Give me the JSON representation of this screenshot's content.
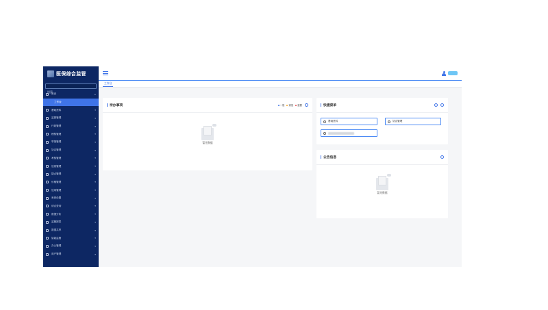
{
  "app": {
    "title": "医保综合监管",
    "search_placeholder": "搜索",
    "accent": "#3f74e8",
    "sidebar_bg": "#0d2763"
  },
  "sidebar": {
    "items": [
      {
        "label": "首页",
        "icon": "home-icon",
        "state": "open"
      },
      {
        "label": "工作台",
        "icon": "",
        "state": "active"
      },
      {
        "label": "基础资料",
        "icon": "database-icon",
        "state": ""
      },
      {
        "label": "监督管理",
        "icon": "shield-icon",
        "state": ""
      },
      {
        "label": "行政管理",
        "icon": "briefcase-icon",
        "state": ""
      },
      {
        "label": "稽核管理",
        "icon": "clipboard-icon",
        "state": ""
      },
      {
        "label": "举报管理",
        "icon": "flag-icon",
        "state": ""
      },
      {
        "label": "协议管理",
        "icon": "document-icon",
        "state": ""
      },
      {
        "label": "考核管理",
        "icon": "chart-icon",
        "state": ""
      },
      {
        "label": "信息管理",
        "icon": "info-icon",
        "state": ""
      },
      {
        "label": "疑点管理",
        "icon": "alert-icon",
        "state": ""
      },
      {
        "label": "价格管理",
        "icon": "tag-icon",
        "state": ""
      },
      {
        "label": "信用管理",
        "icon": "star-icon",
        "state": ""
      },
      {
        "label": "系统设置",
        "icon": "gear-icon",
        "state": ""
      },
      {
        "label": "综合查询",
        "icon": "search-icon",
        "state": ""
      },
      {
        "label": "数据分析",
        "icon": "analysis-icon",
        "state": ""
      },
      {
        "label": "监管报表",
        "icon": "report-icon",
        "state": ""
      },
      {
        "label": "数据共享",
        "icon": "share-icon",
        "state": ""
      },
      {
        "label": "智能监管",
        "icon": "robot-icon",
        "state": ""
      },
      {
        "label": "办公管理",
        "icon": "office-icon",
        "state": ""
      },
      {
        "label": "用户管理",
        "icon": "user-icon",
        "state": ""
      }
    ]
  },
  "tabs": [
    {
      "label": "工作台"
    }
  ],
  "todo": {
    "title": "待办事项",
    "legend": [
      {
        "label": "一般",
        "color": "#3f74e8"
      },
      {
        "label": "紧急",
        "color": "#f5a623"
      },
      {
        "label": "重要",
        "color": "#e84a4a"
      }
    ],
    "empty_text": "暂无数据"
  },
  "quick": {
    "title": "快捷菜单",
    "items": [
      {
        "label": "基础资料",
        "blurred": false
      },
      {
        "label": "协议管理",
        "blurred": false
      },
      {
        "label": "",
        "blurred": true
      }
    ]
  },
  "notice": {
    "title": "公告信息",
    "empty_text": "暂无数据"
  }
}
